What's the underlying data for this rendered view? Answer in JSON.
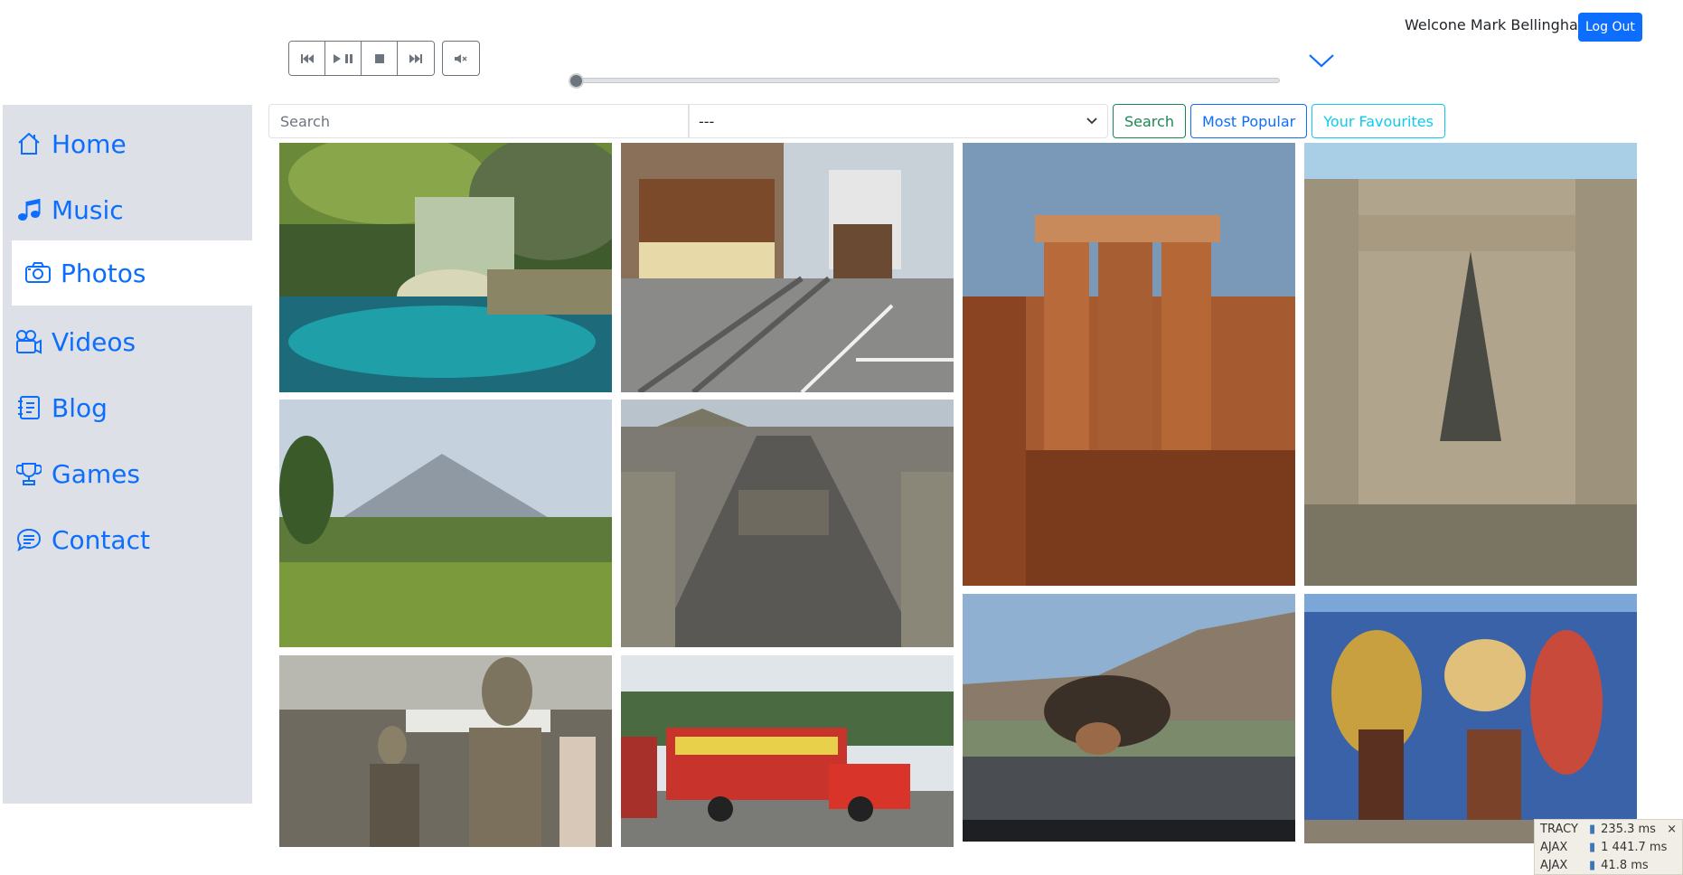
{
  "header": {
    "welcome": "Welcone Mark Bellingham",
    "logout_label": "Log Out"
  },
  "player": {
    "prev_icon": "skip-back-icon",
    "playpause_icon": "play-pause-icon",
    "stop_icon": "stop-icon",
    "next_icon": "skip-forward-icon",
    "mute_icon": "mute-icon",
    "progress": 0.0
  },
  "sidebar": {
    "items": [
      {
        "label": "Home",
        "icon": "home-icon"
      },
      {
        "label": "Music",
        "icon": "music-note-icon"
      },
      {
        "label": "Photos",
        "icon": "camera-icon",
        "active": true
      },
      {
        "label": "Videos",
        "icon": "video-camera-icon"
      },
      {
        "label": "Blog",
        "icon": "journal-icon"
      },
      {
        "label": "Games",
        "icon": "trophy-icon"
      },
      {
        "label": "Contact",
        "icon": "chat-icon"
      }
    ]
  },
  "search": {
    "placeholder": "Search",
    "select_value": "---",
    "search_label": "Search",
    "popular_label": "Most Popular",
    "favourites_label": "Your Favourites"
  },
  "photos": [
    "cenote-pool",
    "cable-car-street",
    "red-rock-hoodoos",
    "mayan-ruin-facade",
    "volcano-grassland",
    "teotihuacan-avenue",
    "bronze-statues",
    "chicken-bus",
    "bison-roadside",
    "street-mural"
  ],
  "tracy": {
    "title": "TRACY",
    "total": "235.3 ms",
    "rows": [
      {
        "label": "AJAX",
        "value": "1 441.7 ms"
      },
      {
        "label": "AJAX",
        "value": "41.8 ms"
      }
    ],
    "close": "×"
  },
  "colors": {
    "primary": "#0d6efd",
    "success": "#198754",
    "info": "#0dcaf0",
    "sidebar_bg": "#dde0e6"
  }
}
